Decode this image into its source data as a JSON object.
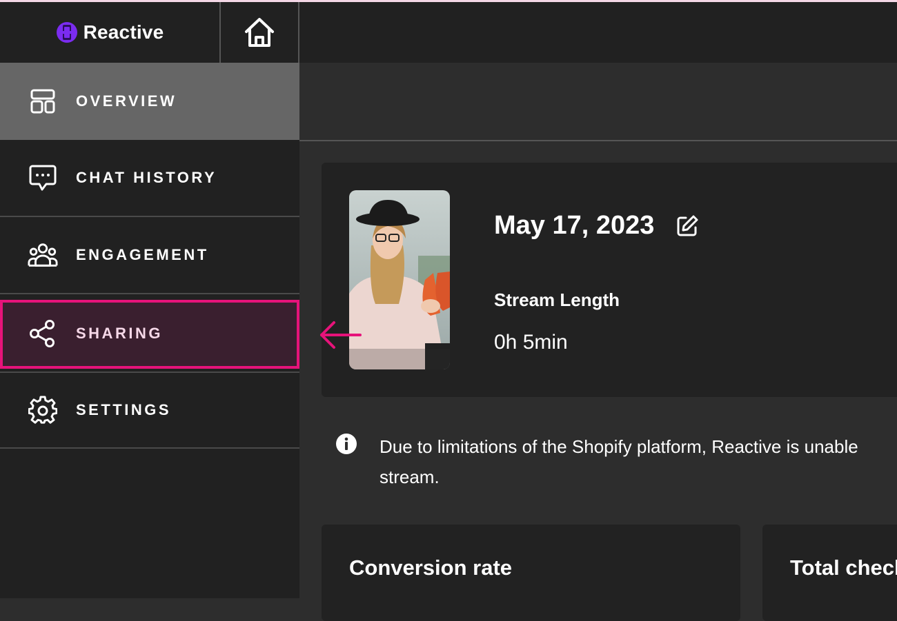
{
  "app": {
    "name": "Reactive"
  },
  "colors": {
    "accent": "#e6137a",
    "brand_logo": "#7b2cf0",
    "active_nav": "#666666"
  },
  "sidebar": {
    "items": [
      {
        "label": "OVERVIEW",
        "icon": "layout-icon",
        "state": "active"
      },
      {
        "label": "CHAT HISTORY",
        "icon": "chat-bubble-icon",
        "state": "default"
      },
      {
        "label": "ENGAGEMENT",
        "icon": "users-icon",
        "state": "default"
      },
      {
        "label": "SHARING",
        "icon": "share-icon",
        "state": "highlighted"
      },
      {
        "label": "SETTINGS",
        "icon": "gear-icon",
        "state": "default"
      }
    ]
  },
  "stream": {
    "date": "May 17, 2023",
    "length_label": "Stream Length",
    "length_value": "0h 5min"
  },
  "notice": {
    "text": "Due to limitations of the Shopify platform, Reactive is unable\nstream."
  },
  "metrics": [
    {
      "title": "Conversion rate"
    },
    {
      "title": "Total check"
    }
  ]
}
